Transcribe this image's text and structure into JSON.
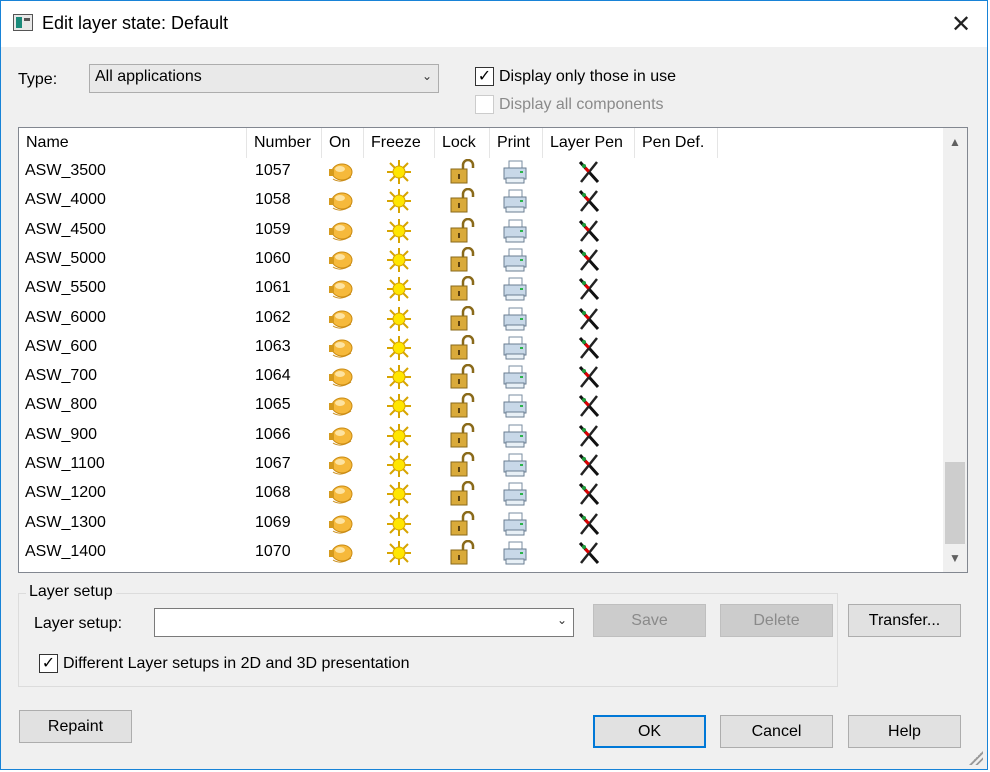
{
  "window": {
    "title": "Edit layer state: Default",
    "close_glyph": "✕"
  },
  "type": {
    "label": "Type:",
    "value": "All applications"
  },
  "options": {
    "display_in_use": {
      "label": "Display only those in use",
      "checked": true
    },
    "display_all_components": {
      "label": "Display all components",
      "checked": false,
      "enabled": false
    }
  },
  "list": {
    "columns": [
      "Name",
      "Number",
      "On",
      "Freeze",
      "Lock",
      "Print",
      "Layer Pen",
      "Pen Def."
    ],
    "rows": [
      {
        "name": "ASW_3500",
        "number": "1057"
      },
      {
        "name": "ASW_4000",
        "number": "1058"
      },
      {
        "name": "ASW_4500",
        "number": "1059"
      },
      {
        "name": "ASW_5000",
        "number": "1060"
      },
      {
        "name": "ASW_5500",
        "number": "1061"
      },
      {
        "name": "ASW_6000",
        "number": "1062"
      },
      {
        "name": "ASW_600",
        "number": "1063"
      },
      {
        "name": "ASW_700",
        "number": "1064"
      },
      {
        "name": "ASW_800",
        "number": "1065"
      },
      {
        "name": "ASW_900",
        "number": "1066"
      },
      {
        "name": "ASW_1100",
        "number": "1067"
      },
      {
        "name": "ASW_1200",
        "number": "1068"
      },
      {
        "name": "ASW_1300",
        "number": "1069"
      },
      {
        "name": "ASW_1400",
        "number": "1070"
      }
    ],
    "icons": {
      "on": "lightbulb-on-icon",
      "freeze": "sun-icon",
      "lock": "unlocked-padlock-icon",
      "print": "printer-icon",
      "layer_pen": "pen-crossed-icon"
    }
  },
  "layer_setup": {
    "group_title": "Layer setup",
    "label": "Layer setup:",
    "value": "",
    "different_setups": {
      "label": "Different Layer setups in 2D and 3D presentation",
      "checked": true
    },
    "save_label": "Save",
    "delete_label": "Delete",
    "transfer_label": "Transfer..."
  },
  "buttons": {
    "repaint": "Repaint",
    "ok": "OK",
    "cancel": "Cancel",
    "help": "Help"
  },
  "colors": {
    "accent": "#0078d7",
    "window_border": "#1883d7",
    "face": "#f0f0f0"
  }
}
